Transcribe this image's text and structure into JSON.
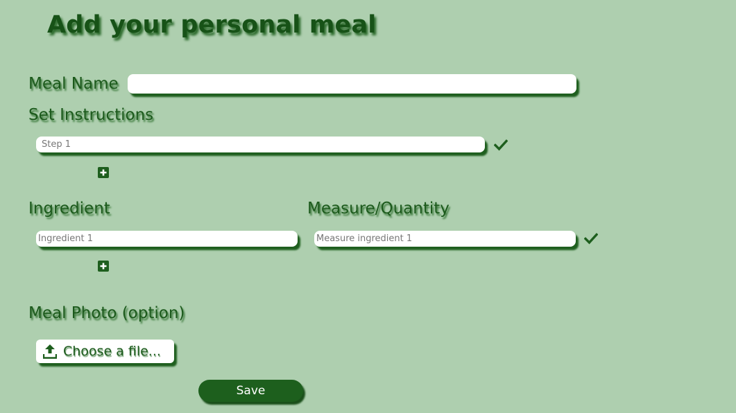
{
  "page": {
    "title": "Add your personal meal"
  },
  "meal_name": {
    "label": "Meal Name",
    "value": "",
    "placeholder": ""
  },
  "instructions": {
    "label": "Set Instructions",
    "steps": [
      {
        "placeholder": "Step 1",
        "value": ""
      }
    ]
  },
  "ingredients": {
    "ingredient_label": "Ingredient",
    "measure_label": "Measure/Quantity",
    "rows": [
      {
        "ingredient_placeholder": "Ingredient 1",
        "measure_placeholder": "Measure ingredient 1"
      }
    ]
  },
  "photo": {
    "label": "Meal Photo (option)",
    "button_label": "Choose a file..."
  },
  "save": {
    "label": "Save"
  },
  "icons": {
    "confirm": "checkmark-icon",
    "add": "plus-square-icon",
    "upload": "upload-icon"
  },
  "colors": {
    "background": "#aecfaf",
    "primary": "#1d5f1d",
    "text": "#1c5a1c"
  }
}
